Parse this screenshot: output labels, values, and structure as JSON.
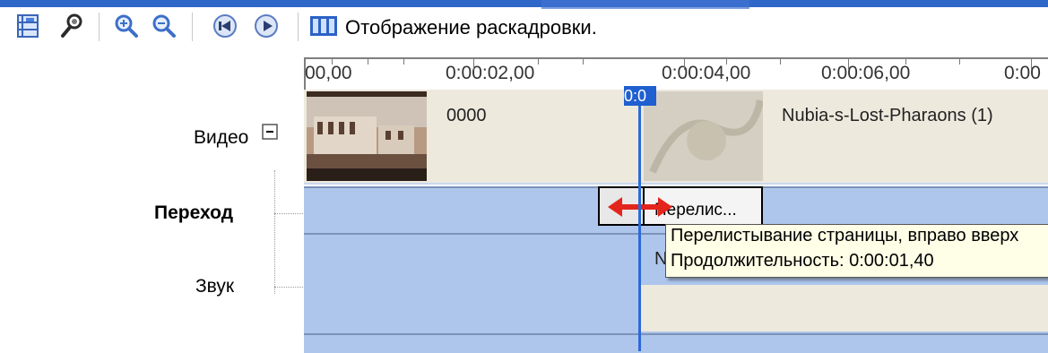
{
  "toolbar": {
    "buttons": [
      {
        "icon": "timeline-icon"
      },
      {
        "icon": "microphone-icon"
      },
      {
        "icon": "zoom-in-icon"
      },
      {
        "icon": "zoom-out-icon"
      },
      {
        "icon": "rewind-icon"
      },
      {
        "icon": "play-icon"
      }
    ],
    "storyboard_icon": "storyboard-icon",
    "storyboard_label": "Отображение раскадровки."
  },
  "ruler": {
    "ticks": [
      "00,00",
      "0:00:02,00",
      "0:00:04,00",
      "0:00:06,00",
      "0:00"
    ],
    "playhead_label": "0:0"
  },
  "tracks": {
    "video_label": "Видео",
    "collapse_icon": "minus-box-icon",
    "transition_label": "Переход",
    "audio_label": "Звук"
  },
  "clips": {
    "first_title": "0000",
    "second_title": "Nubia-s-Lost-Pharaons (1)"
  },
  "transition": {
    "label": "Перелис...",
    "arrow_icon": "double-arrow-icon"
  },
  "audio_partial_text": "N",
  "tooltip": {
    "line1": "Перелистывание страницы, вправо вверх",
    "line2": "Продолжительность:  0:00:01,40"
  }
}
